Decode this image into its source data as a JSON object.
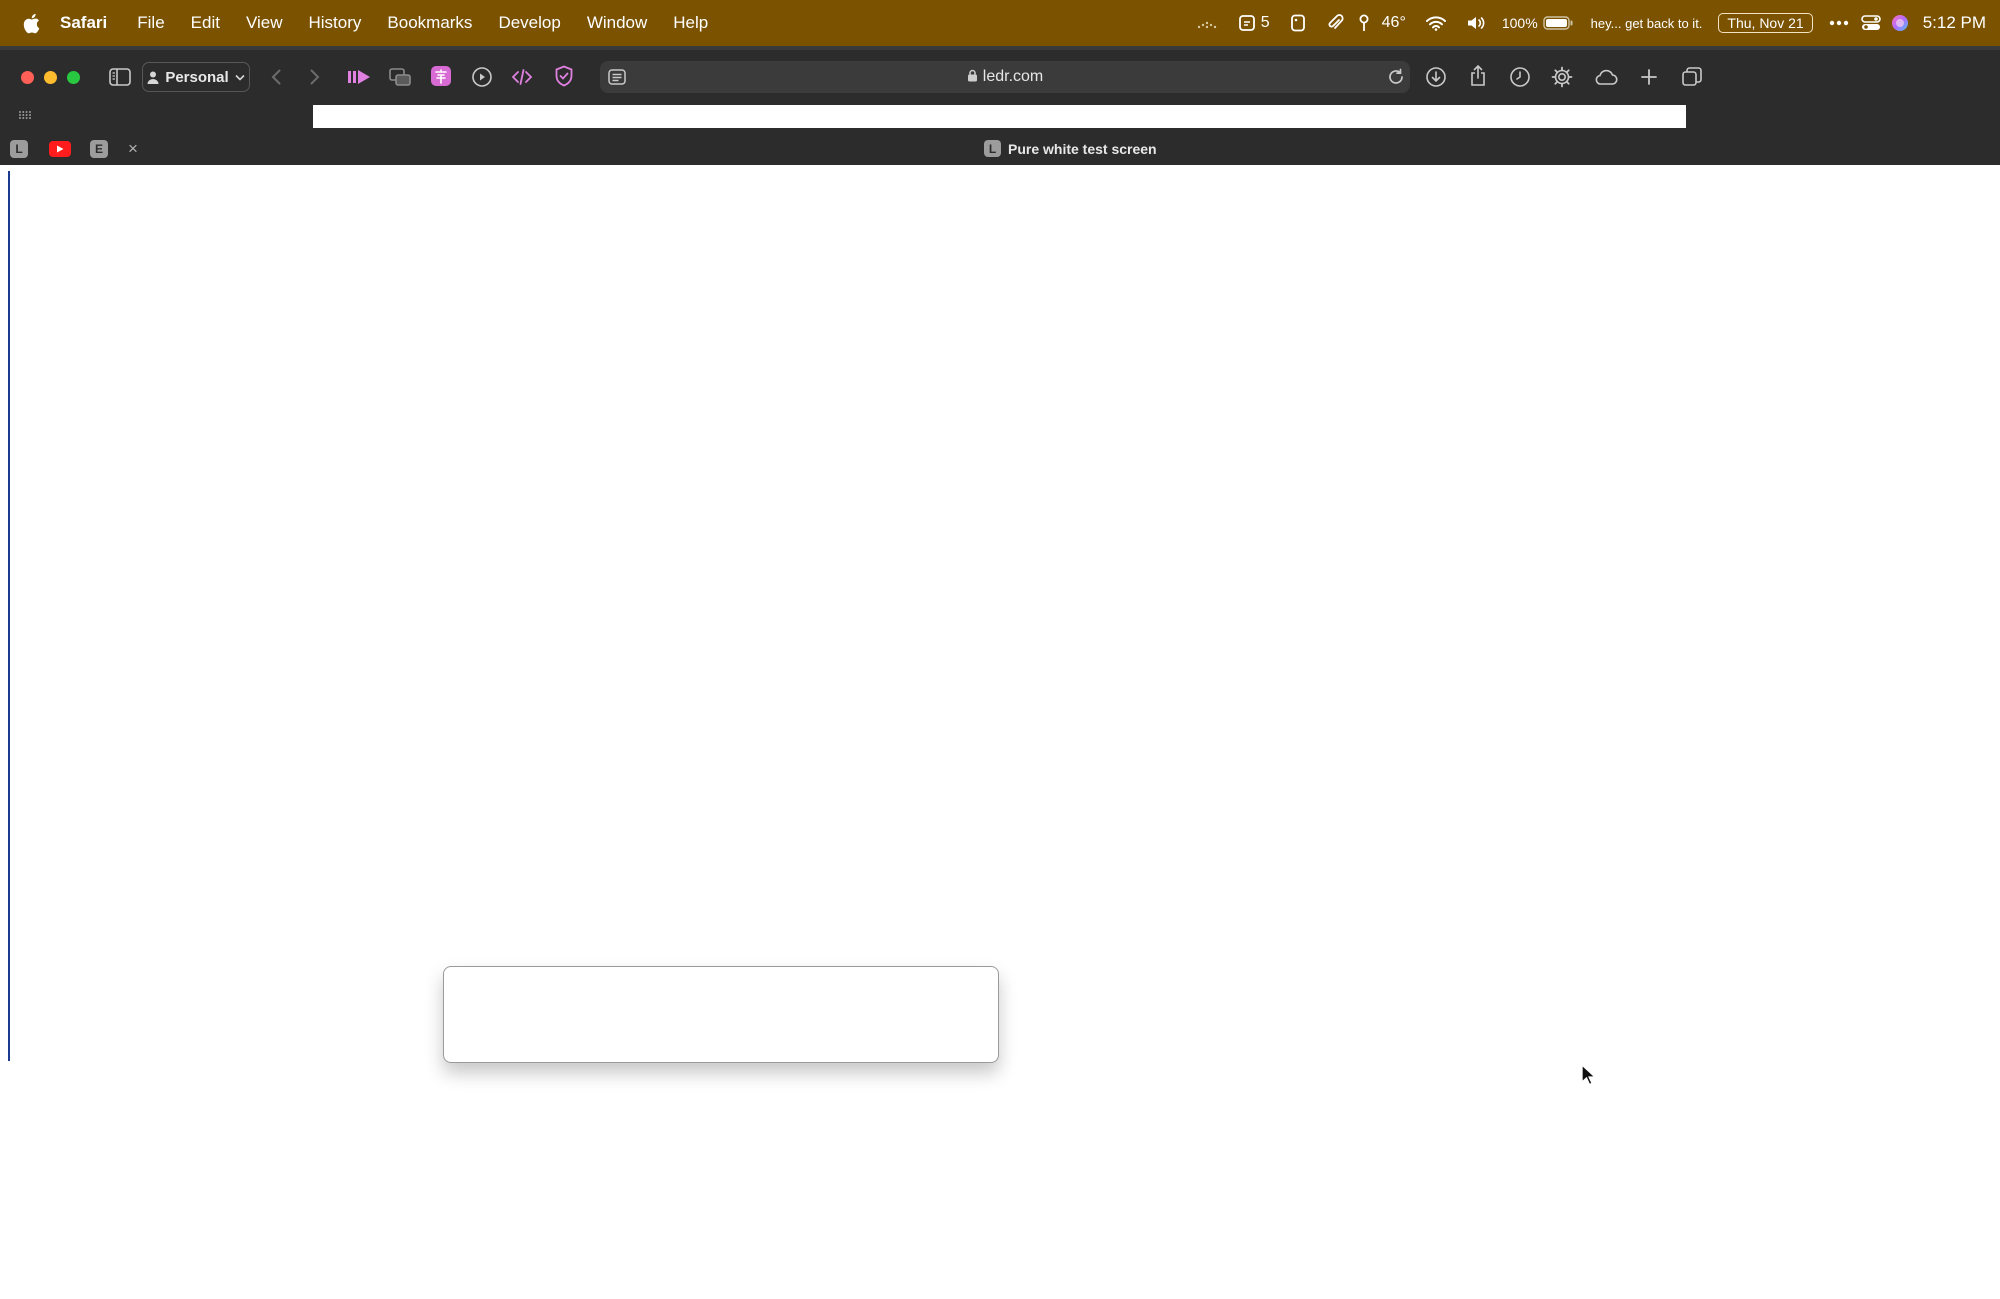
{
  "menubar": {
    "app_name": "Safari",
    "items": [
      "File",
      "Edit",
      "View",
      "History",
      "Bookmarks",
      "Develop",
      "Window",
      "Help"
    ],
    "status": {
      "notes_count": "5",
      "temperature": "46°",
      "battery": "100%",
      "message": "hey... get back to it.",
      "date": "Thu, Nov 21",
      "time": "5:12 PM"
    }
  },
  "toolbar": {
    "profile": "Personal",
    "url": "ledr.com"
  },
  "tabs": {
    "tab1_letter": "L",
    "tab3_letter": "E",
    "close": "×",
    "active_letter": "L",
    "active_title": "Pure white test screen"
  },
  "colors": {
    "menubar": "#7a5200",
    "chrome": "#2c2c2c",
    "accent_pink": "#e33cd4"
  }
}
